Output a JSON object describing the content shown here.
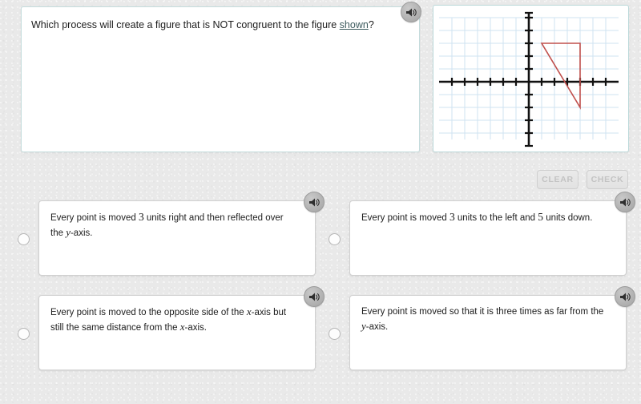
{
  "question": {
    "prefix": "Which process will create a figure that is NOT congruent to the figure ",
    "link_text": "shown",
    "suffix": "?",
    "speaker_icon": "speaker-icon"
  },
  "graph": {
    "x_range": [
      -8,
      8
    ],
    "y_range": [
      -6,
      6
    ],
    "grid": true,
    "grid_color": "#cfe3f2",
    "axis_color": "#000000",
    "shape": {
      "type": "triangle",
      "stroke_color": "#c0504d",
      "vertices": [
        [
          1,
          3
        ],
        [
          4,
          3
        ],
        [
          4,
          -2
        ]
      ]
    }
  },
  "toolbar": {
    "clear_label": "CLEAR",
    "check_label": "CHECK",
    "disabled": true
  },
  "answers": [
    {
      "id": "choice-a",
      "selected": false,
      "speaker_icon": "speaker-icon",
      "text_html": "Every point is moved <span class=\"mnum\">3</span> units right and then reflected over the <span class=\"mvar\">y</span>-axis.",
      "text_plain": "Every point is moved 3 units right and then reflected over the y-axis."
    },
    {
      "id": "choice-b",
      "selected": false,
      "speaker_icon": "speaker-icon",
      "text_html": "Every point is moved <span class=\"mnum\">3</span> units to the left and <span class=\"mnum\">5</span> units down.",
      "text_plain": "Every point is moved 3 units to the left and 5 units down."
    },
    {
      "id": "choice-c",
      "selected": false,
      "speaker_icon": "speaker-icon",
      "text_html": "Every point is moved to the opposite side of the <span class=\"mvar\">x</span>-axis but still the same distance from the <span class=\"mvar\">x</span>-axis.",
      "text_plain": "Every point is moved to the opposite side of the x-axis but still the same distance from the x-axis."
    },
    {
      "id": "choice-d",
      "selected": false,
      "speaker_icon": "speaker-icon",
      "text_html": "Every point is moved so that it is three times as far from the <span class=\"mvar\">y</span>-axis.",
      "text_plain": "Every point is moved so that it is three times as far from the y-axis."
    }
  ],
  "colors": {
    "page_background": "#e9e9e9",
    "panel_background": "#ffffff",
    "question_border": "#c4dcdd",
    "answer_border": "#d0d0d0",
    "link": "#3d5b5e",
    "shape_stroke": "#c0504d",
    "button_text": "#c3c3c3"
  }
}
